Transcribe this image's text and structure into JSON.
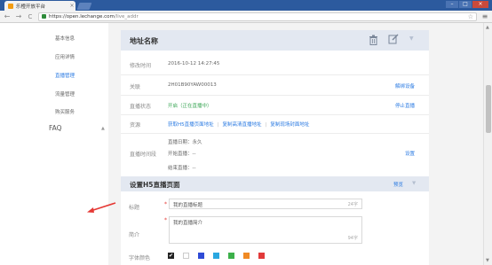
{
  "browser": {
    "tab_title": "乐橙开放平台",
    "tab_close": "×",
    "url_host": "https://open.lechange.com",
    "url_path": "/live_addr",
    "back": "←",
    "forward": "→",
    "reload": "C",
    "star": "☆",
    "menu": "≡",
    "win_min": "–",
    "win_max": "□",
    "win_close": "×"
  },
  "sidebar": {
    "items": [
      {
        "label": "基本信息",
        "active": false
      },
      {
        "label": "应用详情",
        "active": false
      },
      {
        "label": "直播管理",
        "active": true
      },
      {
        "label": "流量管理",
        "active": false
      },
      {
        "label": "购买服务",
        "active": false
      }
    ],
    "faq": "FAQ",
    "faq_chevron": "▲"
  },
  "panel": {
    "title": "地址名称",
    "icons": [
      "trash-icon",
      "edit-icon",
      "chevron-down-icon"
    ],
    "chevron": "▼",
    "rows": {
      "modified": {
        "label": "修改时间",
        "value": "2016-10-12 14:27:45"
      },
      "device": {
        "label": "关联",
        "value": "2H01B90YAW00013",
        "action": "解绑设备"
      },
      "status": {
        "label": "直播状态",
        "value": "开启（正在直播中）",
        "action": "停止直播"
      },
      "resource": {
        "label": "资源",
        "links": [
          "获取H5直播页面地址",
          "复制高清直播地址",
          "复制现场封面地址"
        ],
        "separator": "|"
      },
      "schedule": {
        "label": "直播时间段",
        "date": "直播日期：永久",
        "start": "开始直播：--",
        "end": "结束直播：--",
        "action": "设置"
      }
    }
  },
  "h5": {
    "title": "设置H5直播页面",
    "preview": "预览",
    "chevron": "▼",
    "title_field": {
      "label": "标题",
      "required": "*",
      "value": "我的直播标题",
      "count": "24字"
    },
    "intro_field": {
      "label": "简介",
      "required": "*",
      "value": "我的直播简介",
      "count": "94字"
    },
    "font_color": {
      "label": "字体颜色",
      "selected_mark": "✔",
      "colors": [
        "#222222",
        "#ffffff",
        "#2f4bd6",
        "#2aa7e0",
        "#3cb04a",
        "#f08a24",
        "#e23a3a"
      ]
    }
  },
  "scrollbar": {
    "up": "▲",
    "down": "▼"
  },
  "accent": "#2a7ae2",
  "annotation_color": "#e53935"
}
